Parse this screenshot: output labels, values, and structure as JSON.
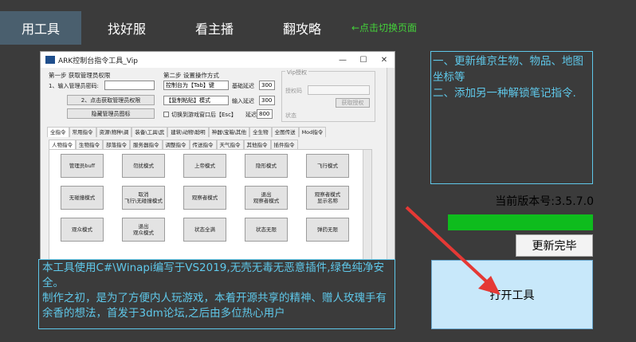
{
  "top_tabs": [
    {
      "label": "用工具"
    },
    {
      "label": "找好服"
    },
    {
      "label": "看主播"
    },
    {
      "label": "翻攻略"
    }
  ],
  "switch_hint": "←点击切换页面",
  "preview": {
    "window_title": "ARK控制台指令工具_Vip",
    "window_controls": {
      "minimize": "—",
      "maximize": "☐",
      "close": "✕"
    },
    "step1": {
      "title": "第一步 获取管理员权限",
      "password_label": "1、输入管理员密码:",
      "get_button": "2、点击获取管理员权限",
      "hide_button": "隐藏管理员图标"
    },
    "step2": {
      "title": "第二步 设置操作方式",
      "mode1": "控制台为【Tab】键",
      "base_delay_label": "基础延迟",
      "base_delay_value": "300",
      "mode2": "【复制粘贴】模式",
      "input_delay_label": "输入延迟",
      "input_delay_value": "300",
      "switch_label": "切换到游戏窗口后【Esc】",
      "switch_delay_label": "延迟",
      "switch_delay_value": "800"
    },
    "vip": {
      "title": "Vip授权",
      "code_label": "授权码",
      "get_auth_button": "获取授权",
      "status_label": "状态"
    },
    "main_tabs": [
      "全指令",
      "常用指令",
      "资源\\物种\\调",
      "装备\\工具\\武",
      "建筑\\动物\\聪明",
      "神器\\宝箱\\其他",
      "全生物",
      "全图传送",
      "Mod指令"
    ],
    "sub_tabs": [
      "人物指令",
      "生物指令",
      "部落指令",
      "服务器指令",
      "调整指令",
      "传送指令",
      "天气指令",
      "其他指令",
      "插件指令"
    ],
    "commands": [
      [
        "管理员buff",
        "勿扰模式",
        "上帝模式",
        "隐形模式",
        "飞行模式"
      ],
      [
        "无碰撞模式",
        "取消\n飞行\\无碰撞模式",
        "观察者模式",
        "退出\n观察者模式",
        "观察者模式\n显示名称"
      ],
      [
        "观众模式",
        "退出\n观众模式",
        "状态全满",
        "状态无限",
        "弹药无限"
      ]
    ]
  },
  "notice_text": "一、更新维京生物、物品、地图坐标等\n二、添加另一种解锁笔记指令.",
  "version_label": "当前版本号:3.5.7.0",
  "progress_value": 1.0,
  "update_button": "更新完毕",
  "open_button": "打开工具",
  "description": "本工具使用C#\\Winapi编写于VS2019,无壳无毒无恶意插件,绿色纯净安全。\n制作之初，是为了方便内人玩游戏，本着开源共享的精神、赠人玫瑰手有余香的想法，首发于3dm论坛,之后由多位热心用户",
  "colors": {
    "background": "#3b3b3b",
    "accent_cyan": "#5fc8ea",
    "hint_green": "#44d13a",
    "progress_green": "#0ebc1d",
    "arrow_red": "#e53935"
  }
}
